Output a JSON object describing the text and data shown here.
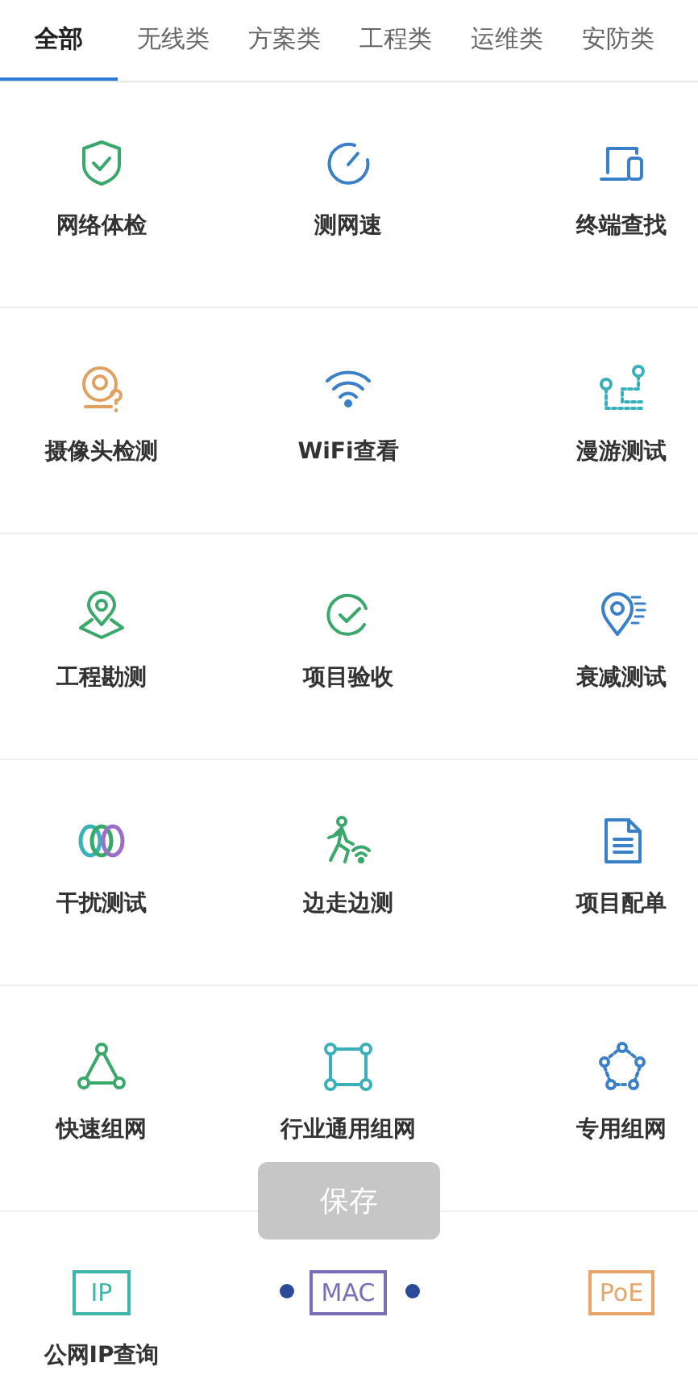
{
  "tabs": [
    {
      "label": "全部",
      "selected": true
    },
    {
      "label": "无线类",
      "selected": false
    },
    {
      "label": "方案类",
      "selected": false
    },
    {
      "label": "工程类",
      "selected": false
    },
    {
      "label": "运维类",
      "selected": false
    },
    {
      "label": "安防类",
      "selected": false
    }
  ],
  "rows": [
    [
      {
        "label": "网络体检"
      },
      {
        "label": "测网速"
      },
      {
        "label": "终端查找"
      }
    ],
    [
      {
        "label": "摄像头检测"
      },
      {
        "label": "WiFi查看"
      },
      {
        "label": "漫游测试"
      }
    ],
    [
      {
        "label": "工程勘测"
      },
      {
        "label": "项目验收"
      },
      {
        "label": "衰减测试"
      }
    ],
    [
      {
        "label": "干扰测试"
      },
      {
        "label": "边走边测"
      },
      {
        "label": "项目配单"
      }
    ],
    [
      {
        "label": "快速组网"
      },
      {
        "label": "行业通用组网"
      },
      {
        "label": "专用组网"
      }
    ],
    [
      {
        "kind": "badge",
        "badge": "IP",
        "color": "#3bb6a8",
        "label": "公网IP查询"
      },
      {
        "kind": "badge",
        "badge": "MAC",
        "color": "#7a6fb8"
      },
      {
        "kind": "badge",
        "badge": "PoE",
        "color": "#e8a56a"
      }
    ]
  ],
  "toast": {
    "text": "保存"
  }
}
